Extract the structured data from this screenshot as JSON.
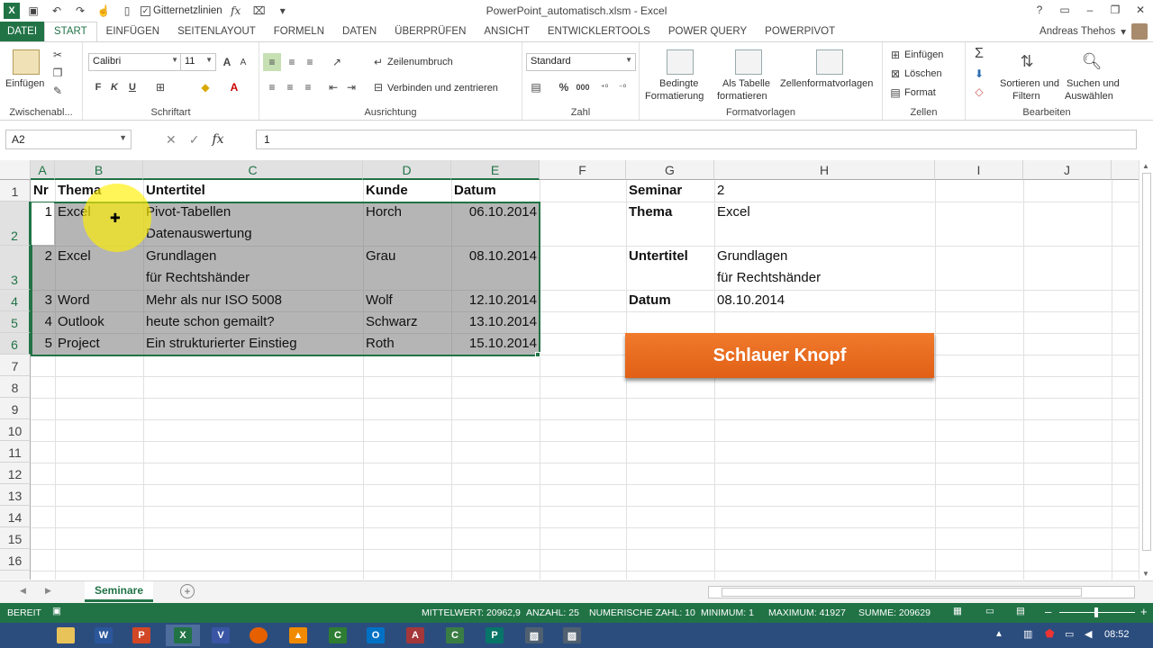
{
  "window": {
    "title": "PowerPoint_automatisch.xlsm - Excel",
    "gridlines_label": "Gitternetzlinien",
    "controls": [
      "?",
      "▭",
      "–",
      "❐",
      "✕"
    ]
  },
  "ribbon_tabs": [
    "DATEI",
    "START",
    "EINFÜGEN",
    "SEITENLAYOUT",
    "FORMELN",
    "DATEN",
    "ÜBERPRÜFEN",
    "ANSICHT",
    "ENTWICKLERTOOLS",
    "POWER QUERY",
    "POWERPIVOT"
  ],
  "active_tab": "START",
  "user": "Andreas Thehos",
  "ribbon": {
    "clipboard": {
      "paste_label": "Einfügen",
      "group": "Zwischenabl..."
    },
    "font": {
      "name": "Calibri",
      "size": "11",
      "bold": "F",
      "italic": "K",
      "underline": "U",
      "group": "Schriftart"
    },
    "alignment": {
      "wrap": "Zeilenumbruch",
      "merge": "Verbinden und zentrieren",
      "group": "Ausrichtung"
    },
    "number": {
      "format": "Standard",
      "percent": "%",
      "thousands": "000",
      "group": "Zahl"
    },
    "styles": {
      "cond_line1": "Bedingte",
      "cond_line2": "Formatierung",
      "table_line1": "Als Tabelle",
      "table_line2": "formatieren",
      "cell_styles": "Zellenformatvorlagen",
      "group": "Formatvorlagen"
    },
    "cells": {
      "insert": "Einfügen",
      "delete": "Löschen",
      "format": "Format",
      "group": "Zellen"
    },
    "editing": {
      "sort_line1": "Sortieren und",
      "sort_line2": "Filtern",
      "find_line1": "Suchen und",
      "find_line2": "Auswählen",
      "group": "Bearbeiten"
    }
  },
  "formula_bar": {
    "name_box": "A2",
    "formula": "1",
    "fx": "fx"
  },
  "columns": [
    "A",
    "B",
    "C",
    "D",
    "E",
    "F",
    "G",
    "H",
    "I",
    "J"
  ],
  "rows": [
    "1",
    "2",
    "3",
    "4",
    "5",
    "6",
    "7",
    "8",
    "9",
    "10",
    "11",
    "12",
    "13",
    "14",
    "15",
    "16"
  ],
  "table": {
    "headers": [
      "Nr",
      "Thema",
      "Untertitel",
      "Kunde",
      "Datum"
    ],
    "rows": [
      {
        "nr": "1",
        "thema": "Excel",
        "untertitel_1": "Pivot-Tabellen",
        "untertitel_2": "Datenauswertung",
        "kunde": "Horch",
        "datum": "06.10.2014"
      },
      {
        "nr": "2",
        "thema": "Excel",
        "untertitel_1": "Grundlagen",
        "untertitel_2": "für Rechtshänder",
        "kunde": "Grau",
        "datum": "08.10.2014"
      },
      {
        "nr": "3",
        "thema": "Word",
        "untertitel_1": "Mehr als nur ISO 5008",
        "untertitel_2": "",
        "kunde": "Wolf",
        "datum": "12.10.2014"
      },
      {
        "nr": "4",
        "thema": "Outlook",
        "untertitel_1": "heute schon gemailt?",
        "untertitel_2": "",
        "kunde": "Schwarz",
        "datum": "13.10.2014"
      },
      {
        "nr": "5",
        "thema": "Project",
        "untertitel_1": "Ein strukturierter Einstieg",
        "untertitel_2": "",
        "kunde": "Roth",
        "datum": "15.10.2014"
      }
    ]
  },
  "detail": {
    "seminar_label": "Seminar",
    "seminar_value": "2",
    "thema_label": "Thema",
    "thema_value": "Excel",
    "untertitel_label": "Untertitel",
    "untertitel_value_1": "Grundlagen",
    "untertitel_value_2": "für Rechtshänder",
    "datum_label": "Datum",
    "datum_value": "08.10.2014"
  },
  "button": {
    "label": "Schlauer Knopf",
    "color": "#e8691f"
  },
  "sheet_tab": "Seminare",
  "status": {
    "mode": "BEREIT",
    "mittelwert": "MITTELWERT: 20962,9",
    "anzahl": "ANZAHL: 25",
    "numerische": "NUMERISCHE ZAHL: 10",
    "minimum": "MINIMUM: 1",
    "maximum": "MAXIMUM: 41927",
    "summe": "SUMME: 209629",
    "zoom_minus": "–",
    "zoom_plus": "+"
  },
  "taskbar": {
    "time": "08:52"
  },
  "colors": {
    "accent": "#217346",
    "taskbar": "#2b4d7e"
  }
}
